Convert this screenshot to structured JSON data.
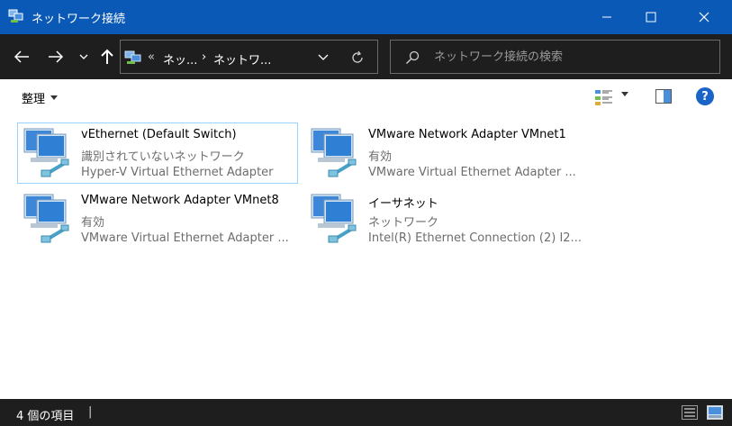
{
  "window": {
    "title": "ネットワーク接続",
    "minimize_icon": "minimize-icon",
    "maximize_icon": "maximize-icon",
    "close_icon": "close-icon"
  },
  "address_bar": {
    "overflow": "«",
    "breadcrumbs": [
      "ネッ...",
      "ネットワ..."
    ],
    "separator": "›",
    "search_placeholder": "ネットワーク接続の検索"
  },
  "command_bar": {
    "organize_label": "整理"
  },
  "items": [
    {
      "name": "vEthernet (Default Switch)",
      "status": "識別されていないネットワーク",
      "device": "Hyper-V Virtual Ethernet Adapter",
      "selected": true
    },
    {
      "name": "VMware Network Adapter VMnet1",
      "status": "有効",
      "device": "VMware Virtual Ethernet Adapter ...",
      "selected": false
    },
    {
      "name": "VMware Network Adapter VMnet8",
      "status": "有効",
      "device": "VMware Virtual Ethernet Adapter ...",
      "selected": false
    },
    {
      "name": "イーサネット",
      "status": "ネットワーク",
      "device": "Intel(R) Ethernet Connection (2) I2...",
      "selected": false
    }
  ],
  "status_bar": {
    "item_count": "4 個の項目",
    "divider": "|"
  },
  "colors": {
    "title_bar": "#0a59b6",
    "dark_bar": "#1e1e1e",
    "selection_border": "#99d1ff",
    "secondary_text": "#6d6d6d"
  }
}
